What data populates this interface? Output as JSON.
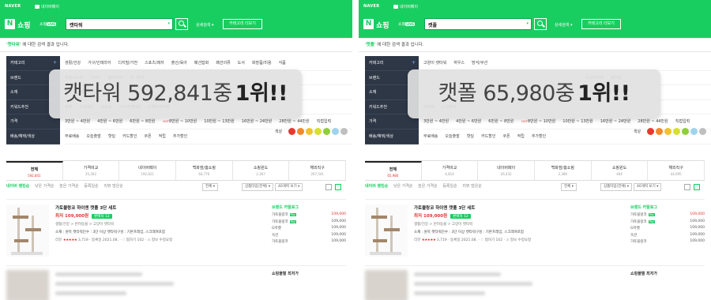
{
  "common": {
    "naver": "NAVER",
    "naverpay": "네이버페이",
    "logo_letter": "N",
    "logo_text": "쇼핑",
    "shop_live_prefix": "쇼핑",
    "live_badge": "LIVE",
    "detail_search": "상세검색 ▾",
    "category_view": "카테고리 더보기",
    "notice_suffix": "에 대한 검색 결과 입니다.",
    "sidebar": [
      "카테고리",
      "브랜드",
      "소재",
      "키워드추천",
      "가격",
      "배송/혜택/색상"
    ],
    "price_row": [
      "3만원 ~ 4만원",
      "4만원 ~ 6만원",
      "6만원 ~ 8만원",
      "8만원 ~ 10만원",
      "10만원 ~ 13만원",
      "16만원 ~ 24만원",
      "28만원 ~ 44만원",
      "직접입력"
    ],
    "hot": "HOT",
    "benefit_row": [
      "무료배송",
      "오늘출발",
      "핫딜",
      "카드할인",
      "쿠폰",
      "적립",
      "추가할인"
    ],
    "color_label": "색상",
    "colors": [
      "#e8392f",
      "#f2892b",
      "#f0c22b",
      "#d7df2f",
      "#8fce3b",
      "#9fd3ec",
      "#bfbfbf"
    ],
    "sort_options": [
      "네이버 랭킹순",
      "낮은 가격순",
      "높은 가격순",
      "등록일순",
      "리뷰 많은순"
    ],
    "select_1": "전체 ▾",
    "select_2": "상품타입(전체) ▾",
    "select_3": "40개씩 보기 ▾",
    "product": {
      "title": "가토블랑코 하이엔 캣폴 3단 세트",
      "price": "최저 109,000원",
      "compare": "판매처 12",
      "category": "생활/건강 > 반려동물 > 고양이 캣타워",
      "spec": "소재 : 원목   캣타워단수 : 3단 이상   캣타워구성 : 기본프레임, 스크래쳐포함",
      "review_label": "리뷰",
      "stars": "★★★★★",
      "review_count": "3,719",
      "reg_date": "등록일 2021.08.",
      "wish": "찜하기 102",
      "report": "정보 수정요청",
      "mall_head": "브랜드 카탈로그",
      "malls": [
        {
          "name": "가토블랑코",
          "pay": "Pay",
          "price": "109,000"
        },
        {
          "name": "가토블랑코",
          "pay": "Pay",
          "price": "109,000"
        },
        {
          "name": "G마켓",
          "pay": "",
          "price": "109,000"
        },
        {
          "name": "옥션",
          "pay": "",
          "price": "109,000"
        },
        {
          "name": "가토블랑코",
          "pay": "",
          "price": "109,000"
        }
      ]
    },
    "blur_mall": "쇼핑몰별 최저가"
  },
  "left": {
    "query": "캣타워",
    "notice_keyword": "'캣타워'",
    "category_row": [
      "생활/건강",
      "가구/인테리어",
      "디지털/가전",
      "스포츠/레저",
      "출산/육아",
      "패션잡화",
      "패션의류",
      "도서",
      "화장품/미용",
      "식품"
    ],
    "brand_row": [
      "캣폴스토리",
      "이케아",
      "블랙아이",
      "루나파크"
    ],
    "material_row": [
      "원목",
      "메탈",
      "원목",
      "대리석"
    ],
    "keyword_row": [
      "캣폴",
      "스크래쳐",
      "숨숨집",
      "아이엠캣타워",
      "이케아캣타워"
    ],
    "overlay_text": "캣타워 592,841중",
    "overlay_rank": "1위!!",
    "tabs": [
      {
        "label": "전체",
        "count": "592,841"
      },
      {
        "label": "가격비교",
        "count": "25,262"
      },
      {
        "label": "네이버페이",
        "count": "192,621"
      },
      {
        "label": "백화점/홈쇼핑",
        "count": "64,776"
      },
      {
        "label": "쇼핑윈도",
        "count": "2,367"
      },
      {
        "label": "해외직구",
        "count": "267,541"
      }
    ]
  },
  "right": {
    "query": "캣폴",
    "notice_keyword": "'캣폴'",
    "category_row": [
      "고양이 캣타워",
      "하우스",
      "방석/쿠션"
    ],
    "brand_row": [
      "오브바이펫",
      "베이원"
    ],
    "material_row": [
      "원목",
      "메탈"
    ],
    "keyword_row": [
      "캣타워",
      "스크래쳐"
    ],
    "overlay_text": "캣폴 65,980중",
    "overlay_rank": "1위!!",
    "tabs": [
      {
        "label": "전체",
        "count": "65,980"
      },
      {
        "label": "가격비교",
        "count": "4,814"
      },
      {
        "label": "네이버페이",
        "count": "26,432"
      },
      {
        "label": "백화점/홈쇼핑",
        "count": "2,380"
      },
      {
        "label": "쇼핑윈도",
        "count": "404"
      },
      {
        "label": "해외직구",
        "count": "44,095"
      }
    ]
  }
}
